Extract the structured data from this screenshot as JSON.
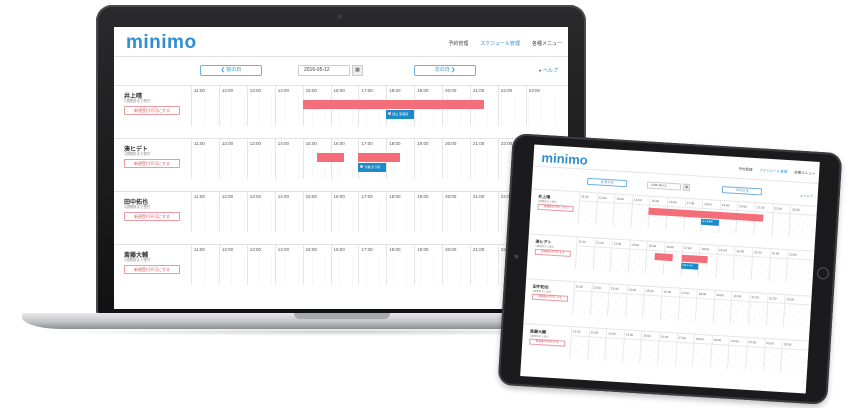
{
  "app": {
    "logo": "minimo",
    "nav": [
      "予約管理",
      "スケジュール管理",
      "各種メニュー"
    ],
    "active_nav_index": 1,
    "prev_day": "❮ 前の日",
    "next_day": "次の日 ❯",
    "date": "2016-05-12",
    "calendar_icon": "calendar-icon",
    "help": "ヘルプ",
    "accent_color": "#2f8fd0",
    "booked_color": "#f46e7a",
    "reservation_color": "#1d8bc7"
  },
  "hours": [
    "11:00",
    "12:00",
    "13:00",
    "14:00",
    "15:00",
    "16:00",
    "17:00",
    "18:00",
    "19:00",
    "20:00",
    "21:00",
    "22:00",
    "23:00"
  ],
  "staff": [
    {
      "name": "井上晴",
      "sub": "1週間前まで受付",
      "button": "新規受付不可にする",
      "red_blocks": [
        {
          "start": 15.0,
          "end": 21.5
        }
      ],
      "blue_blocks": [
        {
          "start": 18.0,
          "end": 19.0,
          "label": "加山 恵美様"
        }
      ]
    },
    {
      "name": "湊ヒデト",
      "sub": "1週間前まで受付",
      "button": "新規受付不可にする",
      "red_blocks": [
        {
          "start": 15.5,
          "end": 16.5
        },
        {
          "start": 17.0,
          "end": 18.5
        }
      ],
      "blue_blocks": [
        {
          "start": 17.0,
          "end": 18.0,
          "label": "大橋 まり様"
        }
      ]
    },
    {
      "name": "田中拓也",
      "sub": "1週間前まで受付",
      "button": "新規受付不可にする",
      "red_blocks": [],
      "blue_blocks": []
    },
    {
      "name": "斎藤大輔",
      "sub": "1週間前まで受付",
      "button": "新規受付不可にする",
      "red_blocks": [],
      "blue_blocks": []
    }
  ]
}
